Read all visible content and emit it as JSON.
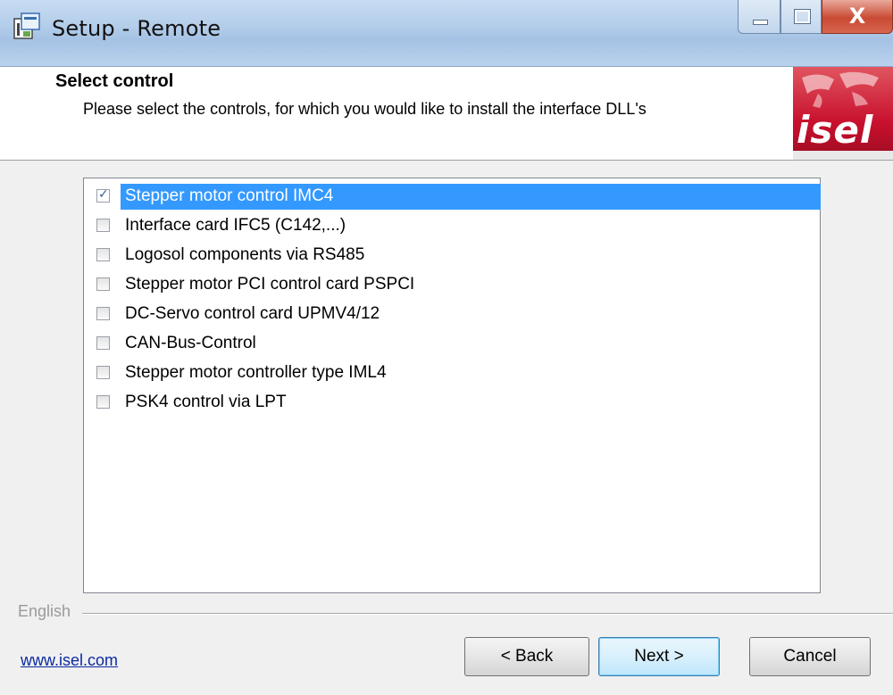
{
  "window": {
    "title": "Setup - Remote"
  },
  "header": {
    "title": "Select control",
    "subtitle": "Please select the controls, for which you would like to install the interface DLL's",
    "logo_text": "isel"
  },
  "controls": [
    {
      "label": "Stepper motor control IMC4",
      "checked": true,
      "selected": true
    },
    {
      "label": "Interface card IFC5 (C142,...)",
      "checked": false
    },
    {
      "label": "Logosol components via RS485",
      "checked": false
    },
    {
      "label": "Stepper motor PCI control card PSPCI",
      "checked": false
    },
    {
      "label": "DC-Servo control card UPMV4/12",
      "checked": false
    },
    {
      "label": "CAN-Bus-Control",
      "checked": false
    },
    {
      "label": "Stepper motor controller type IML4",
      "checked": false
    },
    {
      "label": "PSK4 control via LPT",
      "checked": false
    }
  ],
  "footer": {
    "language": "English",
    "link": "www.isel.com",
    "back_label": "< Back",
    "next_label": "Next >",
    "cancel_label": "Cancel"
  },
  "colors": {
    "selection": "#3399ff",
    "logo_red": "#c8102e",
    "link": "#0b2aa0"
  }
}
